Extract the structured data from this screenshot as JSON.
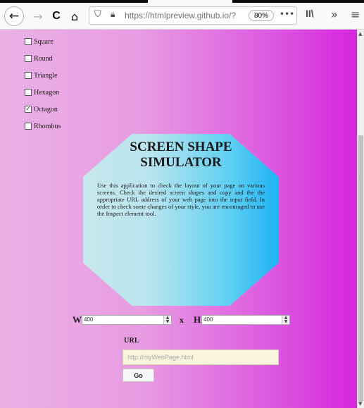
{
  "browser": {
    "back_icon": "←",
    "forward_icon": "→",
    "reload_icon": "C",
    "home_icon": "⌂",
    "url": "https://htmlpreview.github.io/?",
    "zoom": "80%",
    "more_icon": "•••",
    "library_icon": "II\\",
    "overflow_icon": "»",
    "menu_icon": "≡"
  },
  "shapes": [
    {
      "label": "Square",
      "checked": false
    },
    {
      "label": "Round",
      "checked": false
    },
    {
      "label": "Triangle",
      "checked": false
    },
    {
      "label": "Hexagon",
      "checked": false
    },
    {
      "label": "Octagon",
      "checked": true
    },
    {
      "label": "Rhombus",
      "checked": false
    }
  ],
  "checkmark": "✓",
  "simulator": {
    "title": "SCREEN SHAPE\nSIMULATOR",
    "description": "Use this application to check the layout of your page on various screens. Check the desired screen shapes and copy and the the appropriate URL address of your web page into the input field. In order to check some changes of your style, you are encouraged to use the Inspect element tool."
  },
  "dimensions": {
    "width_label": "W",
    "width_value": "400",
    "separator": "x",
    "height_label": "H",
    "height_value": "400",
    "spin_up": "▲",
    "spin_down": "▼"
  },
  "url_form": {
    "label": "URL",
    "placeholder": "http://myWebPage.html",
    "button_label": "Go"
  },
  "colors": {
    "page_gradient_start": "#ebb1e6",
    "page_gradient_end": "#d625de",
    "octagon_gradient_start": "#c8e8ec",
    "octagon_gradient_end": "#1fb3f5",
    "url_input_bg": "#f9f4dc"
  }
}
